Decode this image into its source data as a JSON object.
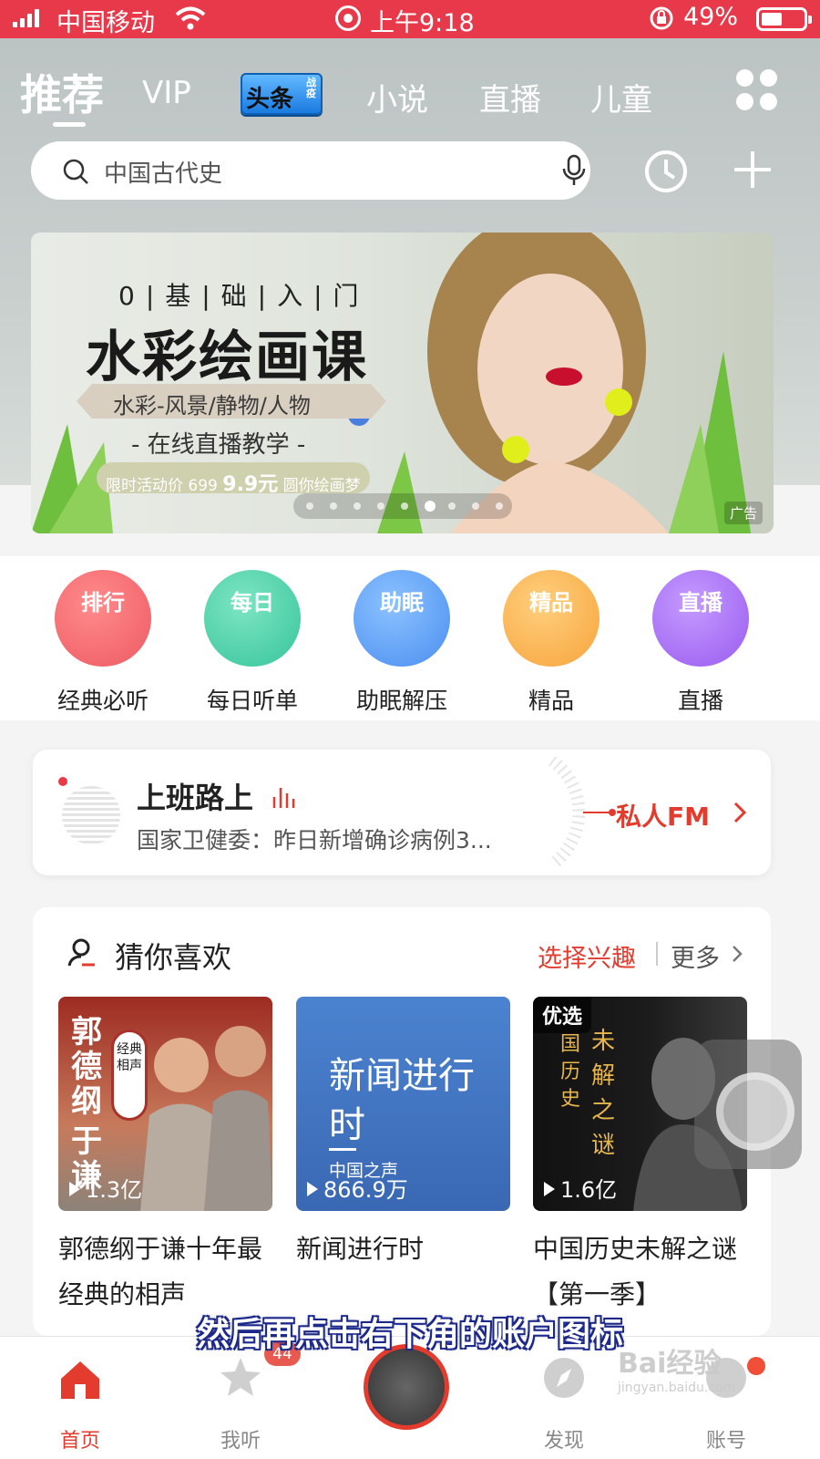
{
  "status_bar": {
    "carrier": "中国移动",
    "time": "上午9:18",
    "battery": "49%"
  },
  "top_tabs": [
    {
      "label": "推荐",
      "active": true
    },
    {
      "label": "VIP"
    },
    {
      "label": "头条",
      "badge_small": "战疫"
    },
    {
      "label": "小说"
    },
    {
      "label": "直播"
    },
    {
      "label": "儿童"
    }
  ],
  "search": {
    "placeholder": "中国古代史"
  },
  "banner": {
    "line1": "0|基|础|入|门",
    "line2": "水彩绘画课",
    "line3": "水彩-风景/静物/人物",
    "line4": "- 在线直播教学 -",
    "promo_prefix": "限时活动价",
    "old_price": "699",
    "new_price": "9.9元",
    "promo_suffix": "圆你绘画梦",
    "ad_label": "广告"
  },
  "categories": [
    {
      "icon_text": "排行",
      "label": "经典必听",
      "color": "#ee5a64"
    },
    {
      "icon_text": "每日",
      "label": "每日听单",
      "color": "#36c59b"
    },
    {
      "icon_text": "助眠",
      "label": "助眠解压",
      "color": "#4a8ef0"
    },
    {
      "icon_text": "精品",
      "label": "精品",
      "color": "#f7a43c"
    },
    {
      "icon_text": "直播",
      "label": "直播",
      "color": "#9a5bf0"
    }
  ],
  "fm": {
    "title": "上班路上",
    "subtitle": "国家卫健委：昨日新增确诊病例3...",
    "action": "私人FM"
  },
  "guess": {
    "title": "猜你喜欢",
    "select_interest": "选择兴趣",
    "more": "更多",
    "cards": [
      {
        "cover_line1": "郭德纲",
        "cover_line2": "于谦",
        "cover_seal": "经典相声",
        "plays": "1.3亿",
        "title": "郭德纲于谦十年最经典的相声"
      },
      {
        "cover_title": "新闻进行时",
        "cover_sub": "中国之声",
        "plays": "866.9万",
        "title": "新闻进行时"
      },
      {
        "cover_tag": "优选",
        "cover_v1": "国历史",
        "cover_v2": "未解之谜",
        "plays": "1.6亿",
        "title": "中国历史未解之谜【第一季】"
      }
    ]
  },
  "subtitle_overlay": "然后再点击右下角的账户图标",
  "tab_bar": [
    {
      "label": "首页",
      "active": true
    },
    {
      "label": "我听",
      "badge": "44"
    },
    {
      "label": ""
    },
    {
      "label": "发现"
    },
    {
      "label": "账号"
    }
  ],
  "watermark": {
    "brand": "Bai经验",
    "url": "jingyan.baidu.com"
  },
  "colors": {
    "accent": "#e33b2e",
    "status_bar": "#e8394a"
  }
}
